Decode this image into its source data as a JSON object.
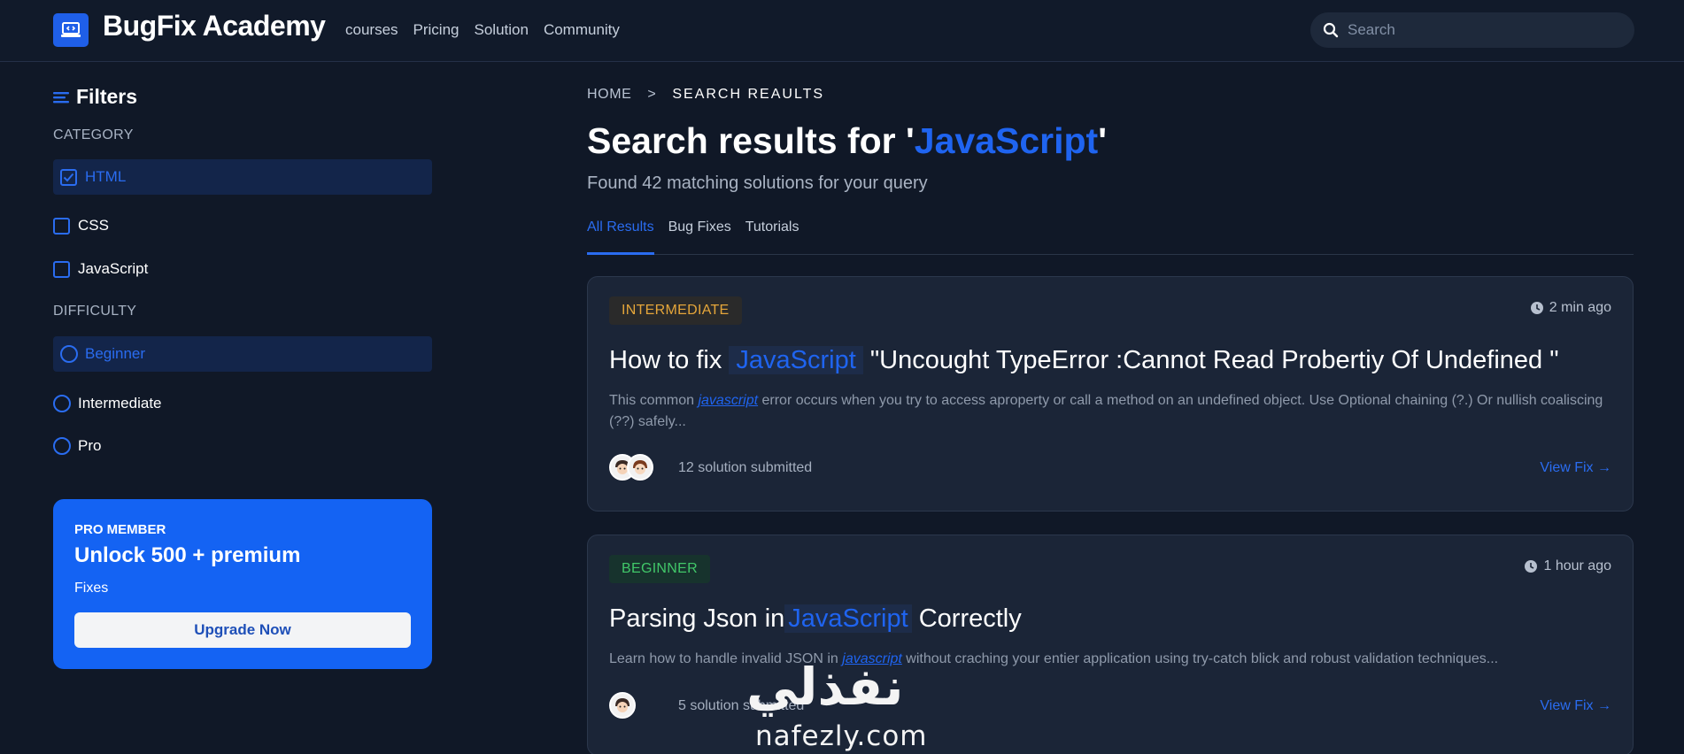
{
  "header": {
    "brand": "BugFix Academy",
    "nav": [
      "courses",
      "Pricing",
      "Solution",
      "Community"
    ],
    "search_placeholder": "Search"
  },
  "sidebar": {
    "title": "Filters",
    "category_label": "CATEGORY",
    "categories": [
      {
        "label": "HTML",
        "checked": true
      },
      {
        "label": "CSS",
        "checked": false
      },
      {
        "label": "JavaScript",
        "checked": false
      }
    ],
    "difficulty_label": "DIFFICULTY",
    "difficulties": [
      {
        "label": "Beginner",
        "selected": true
      },
      {
        "label": "Intermediate",
        "selected": false
      },
      {
        "label": "Pro",
        "selected": false
      }
    ],
    "promo": {
      "tag": "PRO MEMBER",
      "headline": "Unlock 500 + premium",
      "sub": "Fixes",
      "button": "Upgrade Now"
    }
  },
  "main": {
    "breadcrumb": {
      "home": "HOME",
      "sep": ">",
      "current": "SEARCH REAULTS"
    },
    "title_prefix": "Search results for '",
    "query": "JavaScript",
    "title_suffix": "'",
    "subtitle": "Found 42 matching solutions for your query",
    "tabs": [
      "All Results",
      "Bug Fixes",
      "Tutorials"
    ],
    "results": [
      {
        "level": "INTERMEDIATE",
        "time": "2 min ago",
        "title_pre": "How to fix",
        "title_kw": "JavaScript",
        "title_post": "\"Uncought TypeError :Cannot Read Probertiy Of Undefined \"",
        "desc_pre": "This common ",
        "desc_kw": "javascript",
        "desc_post": " error occurs when you try to access aproperty or call a method on an undefined object. Use Optional chaining (?.) Or nullish coaliscing (??) safely...",
        "solutions": "12 solution submitted",
        "action": "View Fix →"
      },
      {
        "level": "BEGINNER",
        "time": "1 hour ago",
        "title_pre": "Parsing Json in",
        "title_kw": "JavaScript",
        "title_post": "Correctly",
        "desc_pre": "Learn how to handle invalid JSON in ",
        "desc_kw": "javascript",
        "desc_post": " without craching your entier application using try-catch blick and robust validation techniques...",
        "solutions": "5 solution submitted",
        "action": "View Fix →"
      }
    ]
  },
  "watermark": {
    "arabic": "نفذلي",
    "latin": "nafezly.com"
  },
  "colors": {
    "accent": "#1f64f0",
    "background": "#101827",
    "card": "#1b2537",
    "promo": "#1463f3",
    "intermediate": "#e5a63a",
    "beginner": "#41c769"
  }
}
